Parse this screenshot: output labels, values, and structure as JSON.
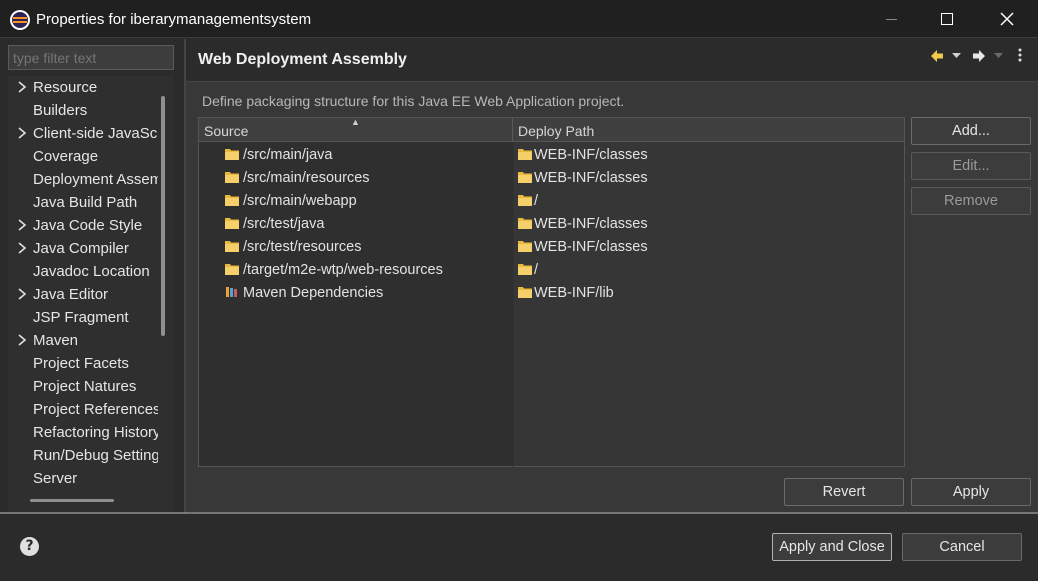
{
  "window": {
    "title": "Properties for iberarymanagementsystem",
    "minimize_icon": "minimize-icon",
    "maximize_icon": "maximize-icon",
    "close_icon": "close-icon"
  },
  "sidebar": {
    "filter_placeholder": "type filter text",
    "items": [
      {
        "label": "Resource",
        "expandable": true
      },
      {
        "label": "Builders",
        "expandable": false
      },
      {
        "label": "Client-side JavaScript",
        "expandable": true
      },
      {
        "label": "Coverage",
        "expandable": false
      },
      {
        "label": "Deployment Assembly",
        "expandable": false
      },
      {
        "label": "Java Build Path",
        "expandable": false
      },
      {
        "label": "Java Code Style",
        "expandable": true
      },
      {
        "label": "Java Compiler",
        "expandable": true
      },
      {
        "label": "Javadoc Location",
        "expandable": false
      },
      {
        "label": "Java Editor",
        "expandable": true
      },
      {
        "label": "JSP Fragment",
        "expandable": false
      },
      {
        "label": "Maven",
        "expandable": true
      },
      {
        "label": "Project Facets",
        "expandable": false
      },
      {
        "label": "Project Natures",
        "expandable": false
      },
      {
        "label": "Project References",
        "expandable": false
      },
      {
        "label": "Refactoring History",
        "expandable": false
      },
      {
        "label": "Run/Debug Settings",
        "expandable": false
      },
      {
        "label": "Server",
        "expandable": false
      }
    ]
  },
  "page": {
    "title": "Web Deployment Assembly",
    "description": "Define packaging structure for this Java EE Web Application project.",
    "nav": {
      "back_icon": "back-arrow-icon",
      "forward_icon": "forward-arrow-icon",
      "menu_icon": "view-menu-icon"
    },
    "table": {
      "columns": [
        "Source",
        "Deploy Path"
      ],
      "rows": [
        {
          "source": "/src/main/java",
          "source_icon": "folder-icon",
          "deploy": "WEB-INF/classes"
        },
        {
          "source": "/src/main/resources",
          "source_icon": "folder-icon",
          "deploy": "WEB-INF/classes"
        },
        {
          "source": "/src/main/webapp",
          "source_icon": "folder-icon",
          "deploy": "/"
        },
        {
          "source": "/src/test/java",
          "source_icon": "folder-icon",
          "deploy": "WEB-INF/classes"
        },
        {
          "source": "/src/test/resources",
          "source_icon": "folder-icon",
          "deploy": "WEB-INF/classes"
        },
        {
          "source": "/target/m2e-wtp/web-resources",
          "source_icon": "folder-icon",
          "deploy": "/"
        },
        {
          "source": "Maven Dependencies",
          "source_icon": "library-icon",
          "deploy": "WEB-INF/lib"
        }
      ]
    },
    "buttons": {
      "add": "Add...",
      "edit": "Edit...",
      "remove": "Remove",
      "revert": "Revert",
      "apply": "Apply"
    }
  },
  "footer": {
    "help_icon": "help-icon",
    "apply_close": "Apply and Close",
    "cancel": "Cancel"
  },
  "colors": {
    "background": "#2b2b2b",
    "panel": "#383838",
    "folder": "#e8b93c"
  }
}
